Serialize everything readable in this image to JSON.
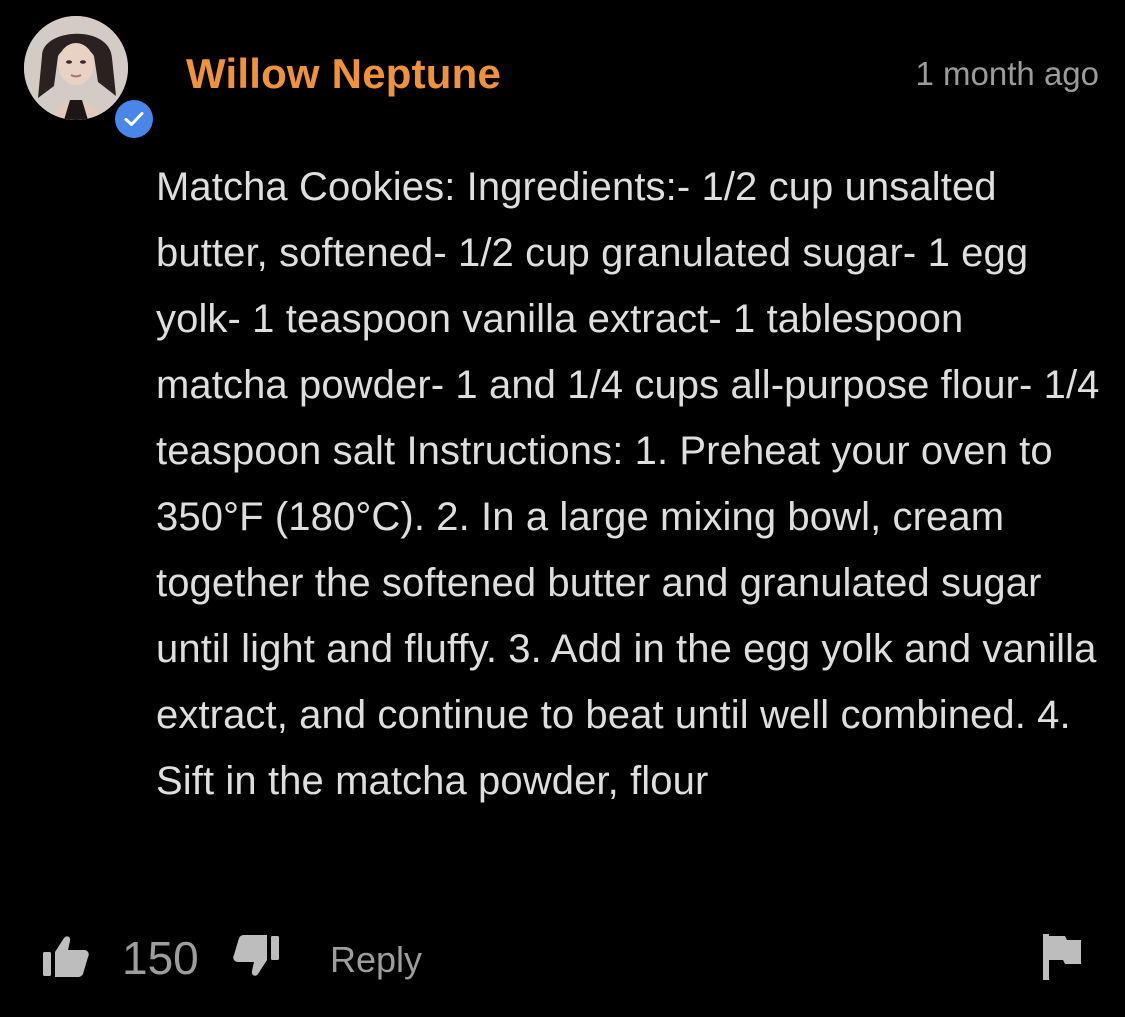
{
  "comment": {
    "author": "Willow Neptune",
    "timestamp": "1 month ago",
    "body": "Matcha Cookies: Ingredients:- 1/2 cup unsalted butter, softened- 1/2 cup granulated sugar- 1 egg yolk- 1 teaspoon vanilla extract- 1 tablespoon matcha powder- 1 and 1/4 cups all-purpose flour- 1/4 teaspoon salt Instructions: 1. Preheat your oven to 350°F (180°C). 2. In a large mixing bowl, cream together the softened butter and granulated sugar until light and fluffy. 3. Add in the egg yolk and vanilla extract, and continue to beat until well combined. 4. Sift in the matcha powder, flour",
    "like_count": "150",
    "reply_label": "Reply",
    "verified": true
  },
  "icons": {
    "verified": "verified-check-icon",
    "like": "thumbs-up-icon",
    "dislike": "thumbs-down-icon",
    "report": "flag-icon"
  },
  "colors": {
    "background": "#000000",
    "author": "#f0923c",
    "verified_badge": "#4a86e8",
    "body_text": "#dedede",
    "muted_text": "#9b9b9b",
    "icon": "#bdbdbd"
  }
}
